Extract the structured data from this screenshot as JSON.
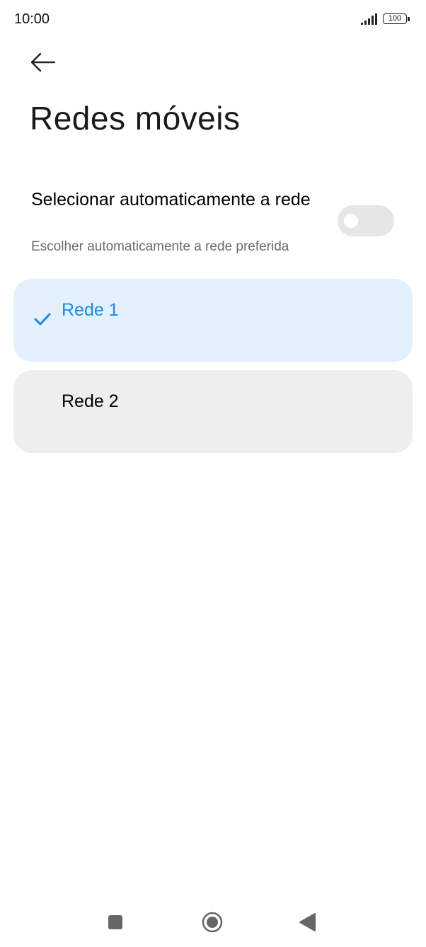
{
  "status_bar": {
    "time": "10:00",
    "battery_level": "100",
    "signal_icon": "signal-bars-icon",
    "battery_icon": "battery-icon"
  },
  "header": {
    "back_icon": "arrow-left-icon",
    "title": "Redes móveis"
  },
  "auto_select": {
    "title": "Selecionar automaticamente a rede",
    "subtitle": "Escolher automaticamente a rede preferida",
    "toggle_on": false
  },
  "networks": [
    {
      "label": "Rede 1",
      "selected": true,
      "icon": "check-icon"
    },
    {
      "label": "Rede 2",
      "selected": false
    }
  ],
  "colors": {
    "accent": "#1a8be6",
    "selected_background": "#e3f0fd",
    "item_background": "#eeeeee",
    "toggle_off_track": "#e6e6e6",
    "subtitle_text": "#6b6b6b"
  },
  "nav_bar": {
    "recents_icon": "square-icon",
    "home_icon": "circle-home-icon",
    "back_icon": "triangle-back-icon"
  }
}
